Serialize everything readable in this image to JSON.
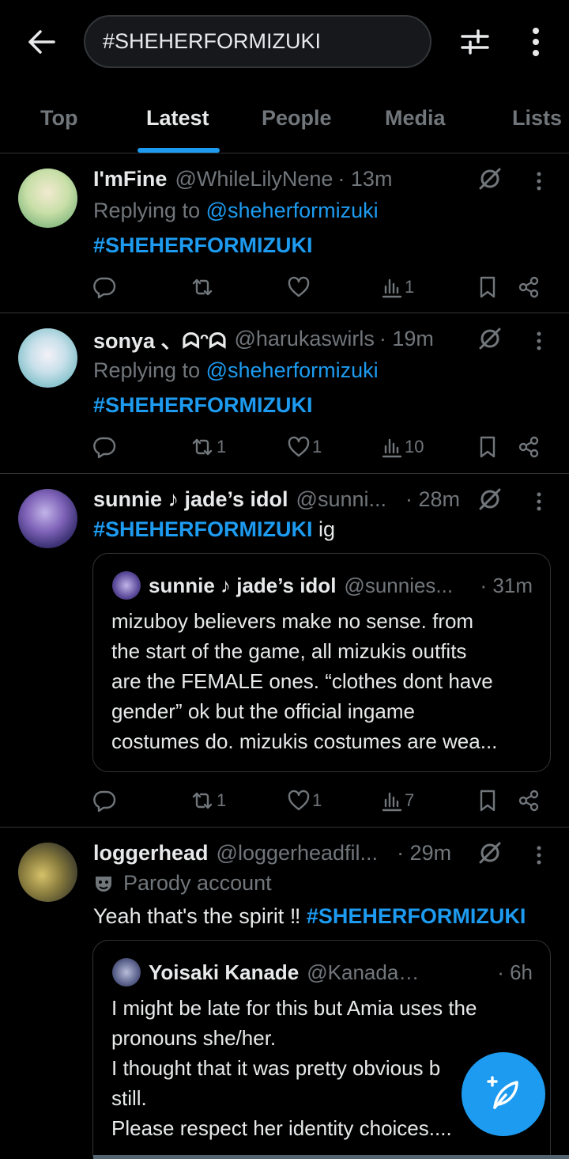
{
  "search": {
    "query": "#SHEHERFORMIZUKI"
  },
  "tabs": [
    "Top",
    "Latest",
    "People",
    "Media",
    "Lists"
  ],
  "active_tab": "Latest",
  "tweets": [
    {
      "name": "I'mFine",
      "handle": "@WhileLilyNene",
      "time": "· 13m",
      "replying_prefix": "Replying to",
      "replying_to": "@sheherformizuki",
      "hashtag": "#SHEHERFORMIZUKI",
      "stats": {
        "replies": "",
        "reposts": "",
        "likes": "",
        "views": "1"
      }
    },
    {
      "name": "sonya 、ᗣᵔᗣ",
      "handle": "@harukaswirls",
      "time": "· 19m",
      "replying_prefix": "Replying to",
      "replying_to": "@sheherformizuki",
      "hashtag": "#SHEHERFORMIZUKI",
      "stats": {
        "replies": "",
        "reposts": "1",
        "likes": "1",
        "views": "10"
      }
    },
    {
      "name": "sunnie ♪ jade’s idol",
      "handle": "@sunni...",
      "time": "· 28m",
      "hashtag": "#SHEHERFORMIZUKI",
      "text_after": " ig",
      "quote": {
        "name": "sunnie ♪ jade’s idol",
        "handle": "@sunnies...",
        "time": "· 31m",
        "lines": [
          "mizuboy believers make no sense. from",
          "the start of the game, all mizukis outfits",
          "are the FEMALE ones. “clothes dont have",
          "gender” ok but the official ingame",
          "costumes do. mizukis costumes are wea..."
        ]
      },
      "stats": {
        "replies": "",
        "reposts": "1",
        "likes": "1",
        "views": "7"
      }
    },
    {
      "name": "loggerhead",
      "handle": "@loggerheadfil...",
      "time": "· 29m",
      "badge": "Parody account",
      "text": "Yeah that's the spirit  ‼ ",
      "hashtag": "#SHEHERFORMIZUKI",
      "quote": {
        "name": "Yoisaki Kanade",
        "handle": "@Kanadacom...",
        "time": "· 6h",
        "lines": [
          "I might be late for this but Amia uses the",
          "pronouns she/her.",
          "I thought that it was pretty obvious b",
          "still.",
          "Please respect her identity choices...."
        ]
      }
    }
  ],
  "colors": {
    "accent": "#1d9bf0",
    "muted": "#71767b",
    "text": "#e7e9ea",
    "border": "#2f3336",
    "background": "#000000"
  },
  "icons": [
    "back-arrow-icon",
    "filter-sliders-icon",
    "more-vertical-icon",
    "grok-icon",
    "reply-icon",
    "repost-icon",
    "like-icon",
    "views-icon",
    "bookmark-icon",
    "share-icon",
    "parody-mask-icon",
    "compose-feather-icon"
  ]
}
